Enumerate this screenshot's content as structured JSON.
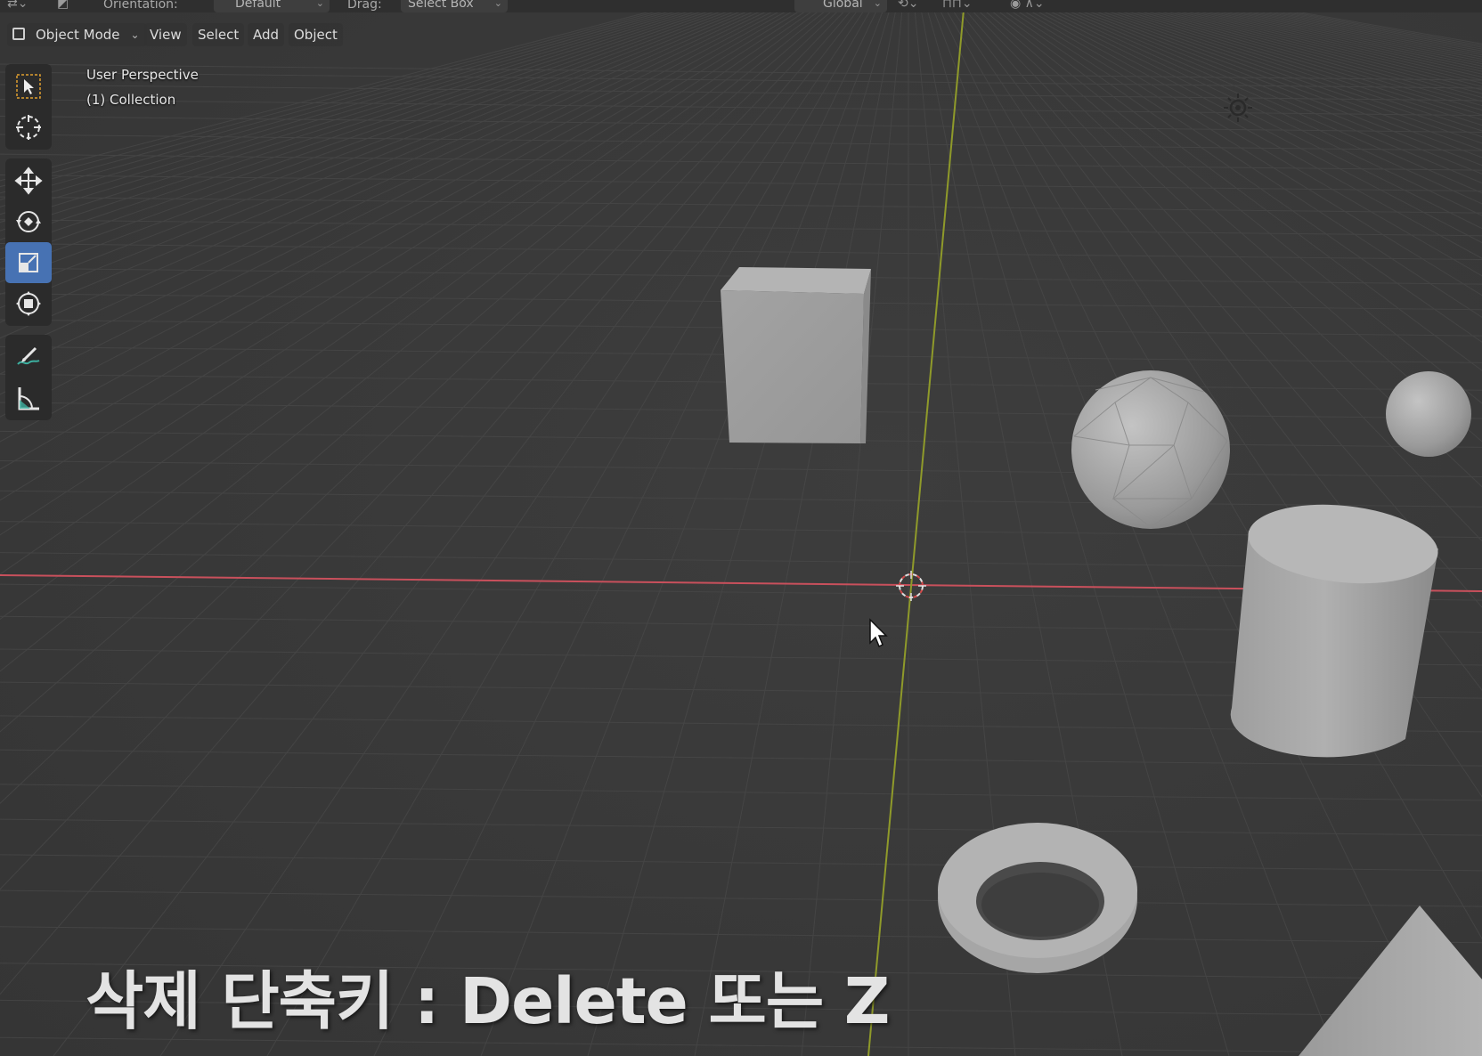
{
  "tool_header": {
    "orientation_label": "Orientation:",
    "orientation_value": "Default",
    "drag_label": "Drag:",
    "drag_value": "Select Box",
    "transform_orientation": "Global"
  },
  "mode_header": {
    "mode": "Object Mode",
    "menus": [
      "View",
      "Select",
      "Add",
      "Object"
    ]
  },
  "toolbar": {
    "tools": [
      "select-box",
      "cursor",
      "move",
      "rotate",
      "scale",
      "transform",
      "annotate",
      "measure"
    ],
    "active_tool": "scale"
  },
  "viewport": {
    "view_name": "User Perspective",
    "collection": "(1) Collection",
    "objects": [
      "Cube",
      "Icosphere",
      "UV Sphere",
      "Cylinder",
      "Torus",
      "Cone"
    ],
    "colors": {
      "background": "#3a3a3a",
      "x_axis": "#c9505c",
      "y_axis": "#8f9a2a",
      "object_gray": "#9d9d9d",
      "active_tool": "#4772b3"
    }
  },
  "subtitle": "삭제 단축키 : Delete 또는 Z"
}
